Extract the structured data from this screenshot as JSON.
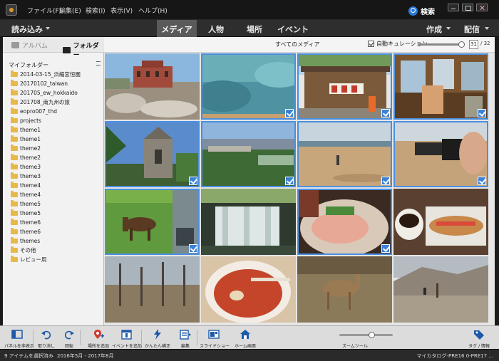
{
  "menubar": {
    "items": [
      "ファイル(F)",
      "編集(E)",
      "検索(I)",
      "表示(V)",
      "ヘルプ(H)"
    ],
    "search_label": "検索"
  },
  "toolbar": {
    "import_label": "読み込み",
    "tabs": [
      "メディア",
      "人物",
      "場所",
      "イベント"
    ],
    "active_tab": "メディア",
    "create_label": "作成",
    "share_label": "配信"
  },
  "sidebar": {
    "tabs": [
      "アルバム",
      "フォルダー"
    ],
    "active_tab": "フォルダー",
    "folder_header": "マイフォルダー",
    "folders": [
      "2014-03-15_浜縮宮恒園",
      "20170102_taiwan",
      "201705_ew_hokkaido",
      "201708_南九州の旅",
      "eopro007_thd",
      "projects",
      "theme1",
      "theme1",
      "theme2",
      "theme2",
      "theme3",
      "theme3",
      "theme4",
      "theme4",
      "theme5",
      "theme5",
      "theme6",
      "theme6",
      "themes",
      "その他",
      "レビュー用"
    ]
  },
  "content": {
    "title": "すべてのメディア",
    "auto_curation_label": "自動キュレーション",
    "auto_curation_checked": true,
    "curation_value": "31",
    "curation_max": "/ 32",
    "curation_level": 0.95
  },
  "grid": {
    "thumbnails": [
      {
        "name": "thumb-red-brick-building",
        "selected": false
      },
      {
        "name": "thumb-clear-water",
        "selected": true
      },
      {
        "name": "thumb-shrine-shop",
        "selected": true
      },
      {
        "name": "thumb-train-interior",
        "selected": true
      },
      {
        "name": "thumb-stone-church",
        "selected": true
      },
      {
        "name": "thumb-city-view",
        "selected": true
      },
      {
        "name": "thumb-beach-person",
        "selected": true
      },
      {
        "name": "thumb-camcorder-hand",
        "selected": true
      },
      {
        "name": "thumb-horse-car-window",
        "selected": true
      },
      {
        "name": "thumb-waterfall",
        "selected": false
      },
      {
        "name": "thumb-sashimi-dish",
        "selected": true
      },
      {
        "name": "thumb-coffee-sandwich",
        "selected": false
      },
      {
        "name": "thumb-bare-forest",
        "selected": false
      },
      {
        "name": "thumb-red-soup",
        "selected": false
      },
      {
        "name": "thumb-deer",
        "selected": false
      },
      {
        "name": "thumb-volcanic-landscape",
        "selected": false
      }
    ]
  },
  "taskbar": {
    "items": [
      {
        "label": "パネルを非表示",
        "icon": "panel-toggle-icon"
      },
      {
        "label": "取り消し",
        "icon": "undo-icon"
      },
      {
        "label": "回転",
        "icon": "rotate-icon"
      },
      {
        "label": "場所を追加",
        "icon": "add-place-icon"
      },
      {
        "label": "イベントを追加",
        "icon": "add-event-icon"
      },
      {
        "label": "かんたん補正",
        "icon": "quick-fix-icon"
      },
      {
        "label": "編集",
        "icon": "edit-icon"
      },
      {
        "label": "スライドショー",
        "icon": "slideshow-icon"
      },
      {
        "label": "ホーム画面",
        "icon": "home-icon"
      }
    ],
    "zoom_label": "ズームツール",
    "zoom_level": 0.6,
    "tags_label": "タグ / 情報"
  },
  "statusbar": {
    "selection": "9 アイテムを選択済み",
    "range": "2016年5月 - 2017年8月",
    "catalog": "マイカタログ-PRE16 0-PRE17 ..."
  },
  "colors": {
    "accent": "#3a82d9",
    "active_tab": "#5a5a5a",
    "folder": "#e8b94a"
  }
}
